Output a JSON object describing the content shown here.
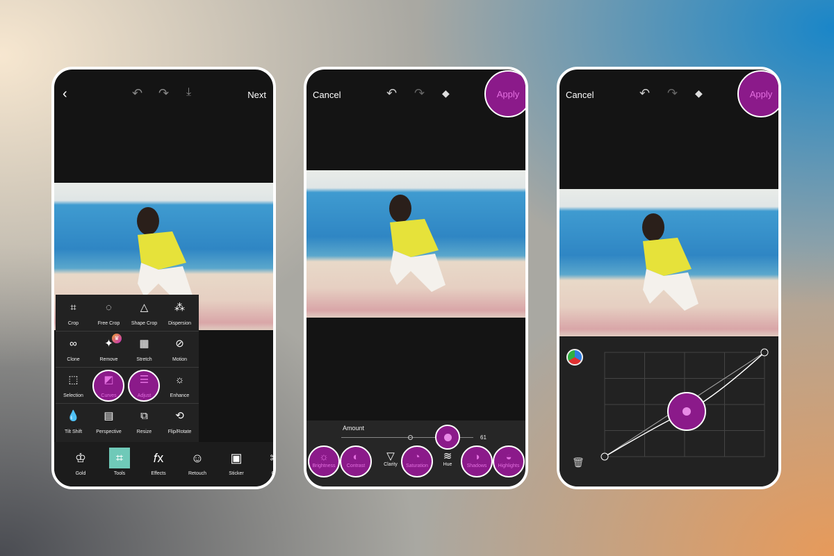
{
  "colors": {
    "accent": "#8b1a8a",
    "accent_light": "#e36fe0",
    "tools_active": "#6fc9b8",
    "panel": "#222222",
    "screen": "#141414"
  },
  "phone1": {
    "top": {
      "back_icon": "chevron-left-icon",
      "next": "Next"
    },
    "tools": [
      [
        {
          "label": "Crop",
          "icon": "crop-icon"
        },
        {
          "label": "Free Crop",
          "icon": "free-crop-icon"
        },
        {
          "label": "Shape Crop",
          "icon": "triangle-icon"
        },
        {
          "label": "Dispersion",
          "icon": "dispersion-icon"
        }
      ],
      [
        {
          "label": "Clone",
          "icon": "clone-icon"
        },
        {
          "label": "Remove",
          "icon": "eraser-sparkle-icon",
          "badge": "crown-badge"
        },
        {
          "label": "Stretch",
          "icon": "stretch-grid-icon"
        },
        {
          "label": "Motion",
          "icon": "motion-icon"
        }
      ],
      [
        {
          "label": "Selection",
          "icon": "selection-icon"
        },
        {
          "label": "Curves",
          "icon": "curves-icon",
          "highlight": true
        },
        {
          "label": "Adjust",
          "icon": "adjust-icon",
          "highlight": true
        },
        {
          "label": "Enhance",
          "icon": "enhance-icon"
        }
      ],
      [
        {
          "label": "Tilt Shift",
          "icon": "drop-icon"
        },
        {
          "label": "Perspective",
          "icon": "perspective-icon"
        },
        {
          "label": "Resize",
          "icon": "resize-icon"
        },
        {
          "label": "Flip/Rotate",
          "icon": "rotate-icon"
        }
      ]
    ],
    "bottom": [
      {
        "label": "Gold",
        "icon": "crown-icon"
      },
      {
        "label": "Tools",
        "icon": "crop-icon",
        "active": true
      },
      {
        "label": "Effects",
        "icon": "fx-icon"
      },
      {
        "label": "Retouch",
        "icon": "face-icon"
      },
      {
        "label": "Sticker",
        "icon": "sticker-icon"
      },
      {
        "label": "Cut",
        "icon": "scissors-icon"
      }
    ]
  },
  "phone2": {
    "cancel": "Cancel",
    "apply": "Apply",
    "amount_label": "Amount",
    "amount_value": "61",
    "amount": 61,
    "adjust_tools": [
      {
        "label": "Brightness",
        "highlight": true
      },
      {
        "label": "Contrast",
        "highlight": true
      },
      {
        "label": "Clarity",
        "highlight": false
      },
      {
        "label": "Saturation",
        "highlight": true
      },
      {
        "label": "Hue",
        "highlight": false
      },
      {
        "label": "Shadows",
        "highlight": true
      },
      {
        "label": "Highlights",
        "highlight": true
      }
    ]
  },
  "phone3": {
    "cancel": "Cancel",
    "apply": "Apply",
    "channel_icon": "rgb-channel-icon",
    "delete_icon": "trash-icon"
  }
}
